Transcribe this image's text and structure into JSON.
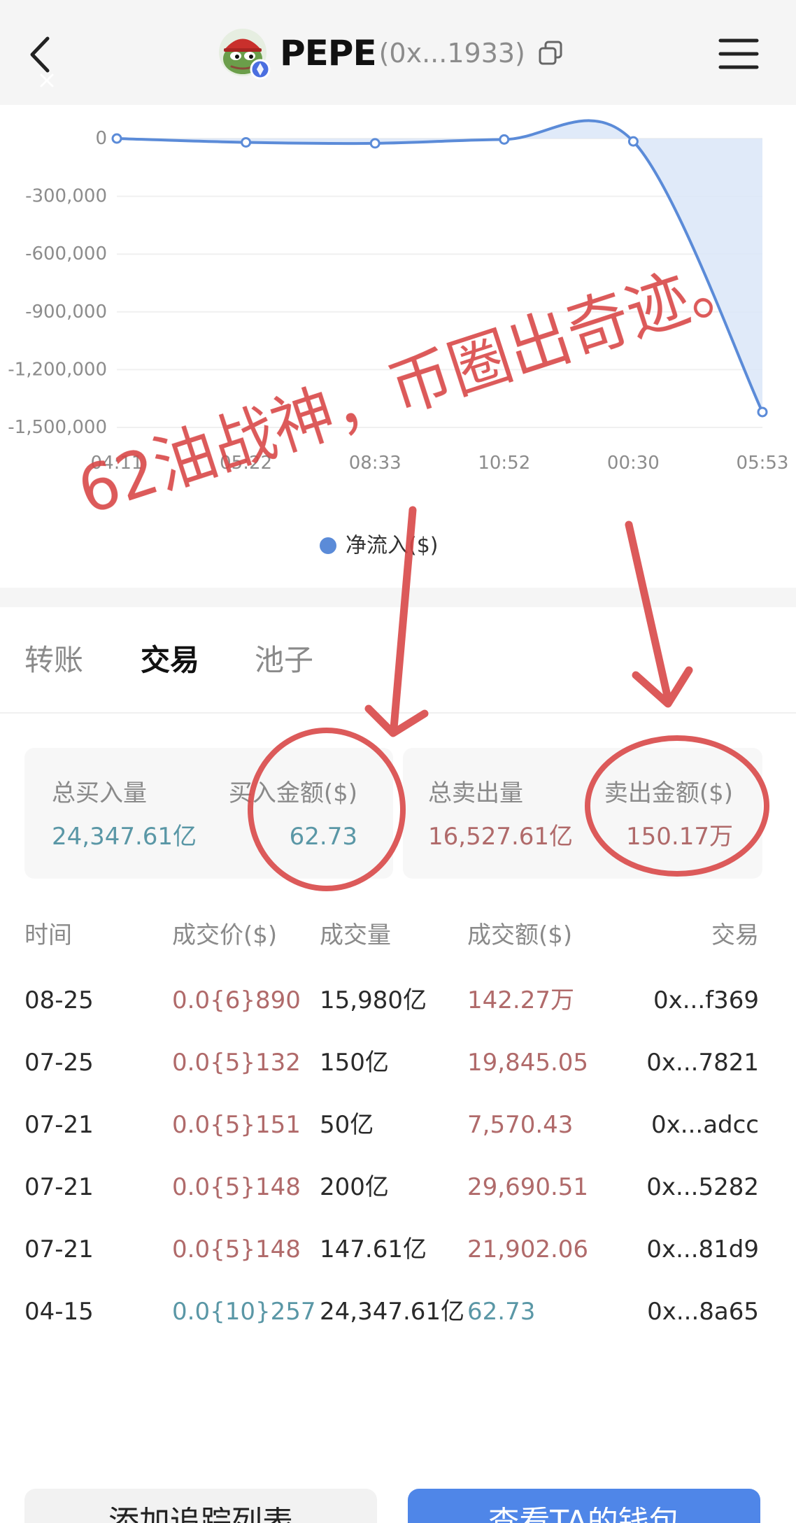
{
  "header": {
    "back_icon": "chevron-left-icon",
    "close_icon": "close-icon",
    "avatar_icon": "pepe-frog-avatar-icon",
    "chain_badge_icon": "ethereum-badge-icon",
    "token_name": "PEPE",
    "address": "(0x...1933)",
    "copy_icon": "copy-icon",
    "menu_icon": "hamburger-menu-icon"
  },
  "chart_data": {
    "type": "line",
    "smooth": true,
    "area": true,
    "grid": true,
    "x": [
      "04:11",
      "05:22",
      "08:33",
      "10:52",
      "00:30",
      "05:53"
    ],
    "yticks": [
      0,
      -300000,
      -600000,
      -900000,
      -1200000,
      -1500000
    ],
    "ytick_labels": [
      "0",
      "-300,000",
      "-600,000",
      "-900,000",
      "-1,200,000",
      "-1,500,000"
    ],
    "ylim": [
      -1500000,
      0
    ],
    "series": [
      {
        "name": "净流入($)",
        "values": [
          0,
          -20000,
          -25000,
          -5000,
          -15000,
          -1420000
        ],
        "color": "#5b8bd8"
      }
    ],
    "legend": "bottom-center"
  },
  "annotation": {
    "text": "62油战神，币圈出奇迹。",
    "color": "#d94848"
  },
  "tabs": [
    {
      "label": "转账",
      "active": false
    },
    {
      "label": "交易",
      "active": true
    },
    {
      "label": "池子",
      "active": false
    }
  ],
  "summary": {
    "buy": {
      "total_label": "总买入量",
      "total_value": "24,347.61亿",
      "amount_label": "买入金额($)",
      "amount_value": "62.73"
    },
    "sell": {
      "total_label": "总卖出量",
      "total_value": "16,527.61亿",
      "amount_label": "卖出金额($)",
      "amount_value": "150.17万"
    }
  },
  "table": {
    "headers": [
      "时间",
      "成交价($)",
      "成交量",
      "成交额($)",
      "交易"
    ],
    "rows": [
      {
        "time": "08-25",
        "price": "0.0{6}890",
        "volume": "15,980亿",
        "amount": "142.27万",
        "tx": "0x...f369",
        "color": "#b06a6a"
      },
      {
        "time": "07-25",
        "price": "0.0{5}132",
        "volume": "150亿",
        "amount": "19,845.05",
        "tx": "0x...7821",
        "color": "#b06a6a"
      },
      {
        "time": "07-21",
        "price": "0.0{5}151",
        "volume": "50亿",
        "amount": "7,570.43",
        "tx": "0x...adcc",
        "color": "#b06a6a"
      },
      {
        "time": "07-21",
        "price": "0.0{5}148",
        "volume": "200亿",
        "amount": "29,690.51",
        "tx": "0x...5282",
        "color": "#b06a6a"
      },
      {
        "time": "07-21",
        "price": "0.0{5}148",
        "volume": "147.61亿",
        "amount": "21,902.06",
        "tx": "0x...81d9",
        "color": "#b06a6a"
      },
      {
        "time": "04-15",
        "price": "0.0{10}257",
        "volume": "24,347.61亿",
        "amount": "62.73",
        "tx": "0x...8a65",
        "color": "#5a97a6"
      }
    ]
  },
  "buttons": {
    "watchlist": "添加追踪列表",
    "wallet": "查看TA的钱包"
  },
  "colors": {
    "sell": "#b06a6a",
    "buy": "#5a97a6",
    "accent": "#4f86e8"
  }
}
